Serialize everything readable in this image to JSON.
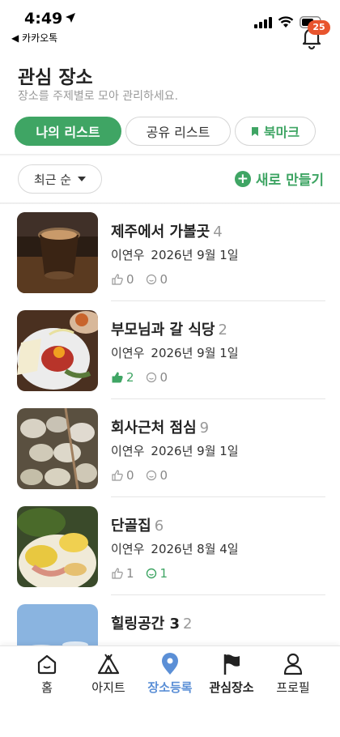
{
  "status_bar": {
    "time": "4:49",
    "back_app": "◀ 카카오톡"
  },
  "header": {
    "title": "관심 장소",
    "subtitle": "장소를 주제별로 모아 관리하세요.",
    "notification_count": "25"
  },
  "tabs": [
    {
      "label": "나의 리스트",
      "active": true
    },
    {
      "label": "공유 리스트",
      "active": false
    },
    {
      "label": "북마크",
      "active": false
    }
  ],
  "filter": {
    "sort_label": "최근 순",
    "new_label": "새로 만들기"
  },
  "items": [
    {
      "title": "제주에서 가볼곳",
      "count": "4",
      "author": "이연우",
      "date": "2026년 9월 1일",
      "likes": "0",
      "comments": "0",
      "likes_active": false,
      "comments_active": false
    },
    {
      "title": "부모님과 갈 식당",
      "count": "2",
      "author": "이연우",
      "date": "2026년 9월 1일",
      "likes": "2",
      "comments": "0",
      "likes_active": true,
      "comments_active": false
    },
    {
      "title": "회사근처 점심",
      "count": "9",
      "author": "이연우",
      "date": "2026년 9월 1일",
      "likes": "0",
      "comments": "0",
      "likes_active": false,
      "comments_active": false
    },
    {
      "title": "단골집",
      "count": "6",
      "author": "이연우",
      "date": "2026년 8월 4일",
      "likes": "1",
      "comments": "1",
      "likes_active": false,
      "comments_active": true
    },
    {
      "title": "힐링공간 3",
      "count": "2"
    }
  ],
  "nav": [
    {
      "label": "홈",
      "icon": "home-icon"
    },
    {
      "label": "아지트",
      "icon": "tent-icon"
    },
    {
      "label": "장소등록",
      "icon": "location-pin-icon",
      "active": true
    },
    {
      "label": "관심장소",
      "icon": "flag-icon"
    },
    {
      "label": "프로필",
      "icon": "person-icon"
    }
  ],
  "colors": {
    "accent": "#3fa564",
    "badge": "#e8552e",
    "nav_active": "#5b8fd6"
  }
}
